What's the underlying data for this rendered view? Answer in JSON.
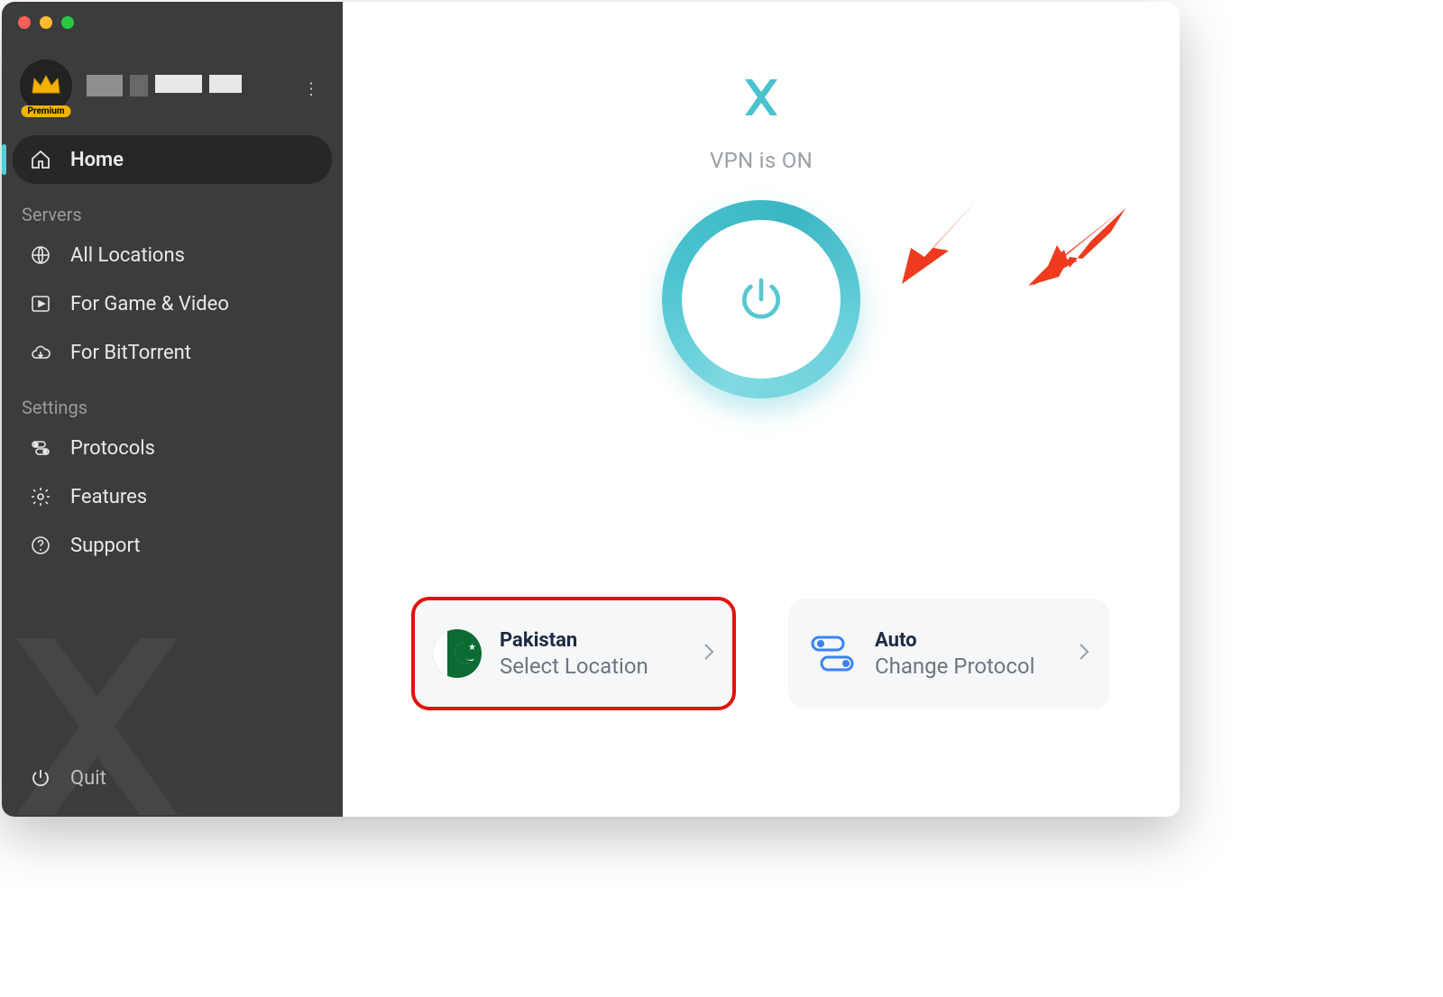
{
  "account": {
    "premium_label": "Premium"
  },
  "sidebar": {
    "home": "Home",
    "section_servers": "Servers",
    "all_locations": "All Locations",
    "game_video": "For Game & Video",
    "bittorrent": "For BitTorrent",
    "section_settings": "Settings",
    "protocols": "Protocols",
    "features": "Features",
    "support": "Support",
    "quit": "Quit"
  },
  "main": {
    "status": "VPN is ON",
    "location_card": {
      "title": "Pakistan",
      "subtitle": "Select Location"
    },
    "protocol_card": {
      "title": "Auto",
      "subtitle": "Change Protocol"
    }
  },
  "colors": {
    "accent_teal": "#4ac3cf",
    "annotation_red": "#ef3a1f"
  }
}
